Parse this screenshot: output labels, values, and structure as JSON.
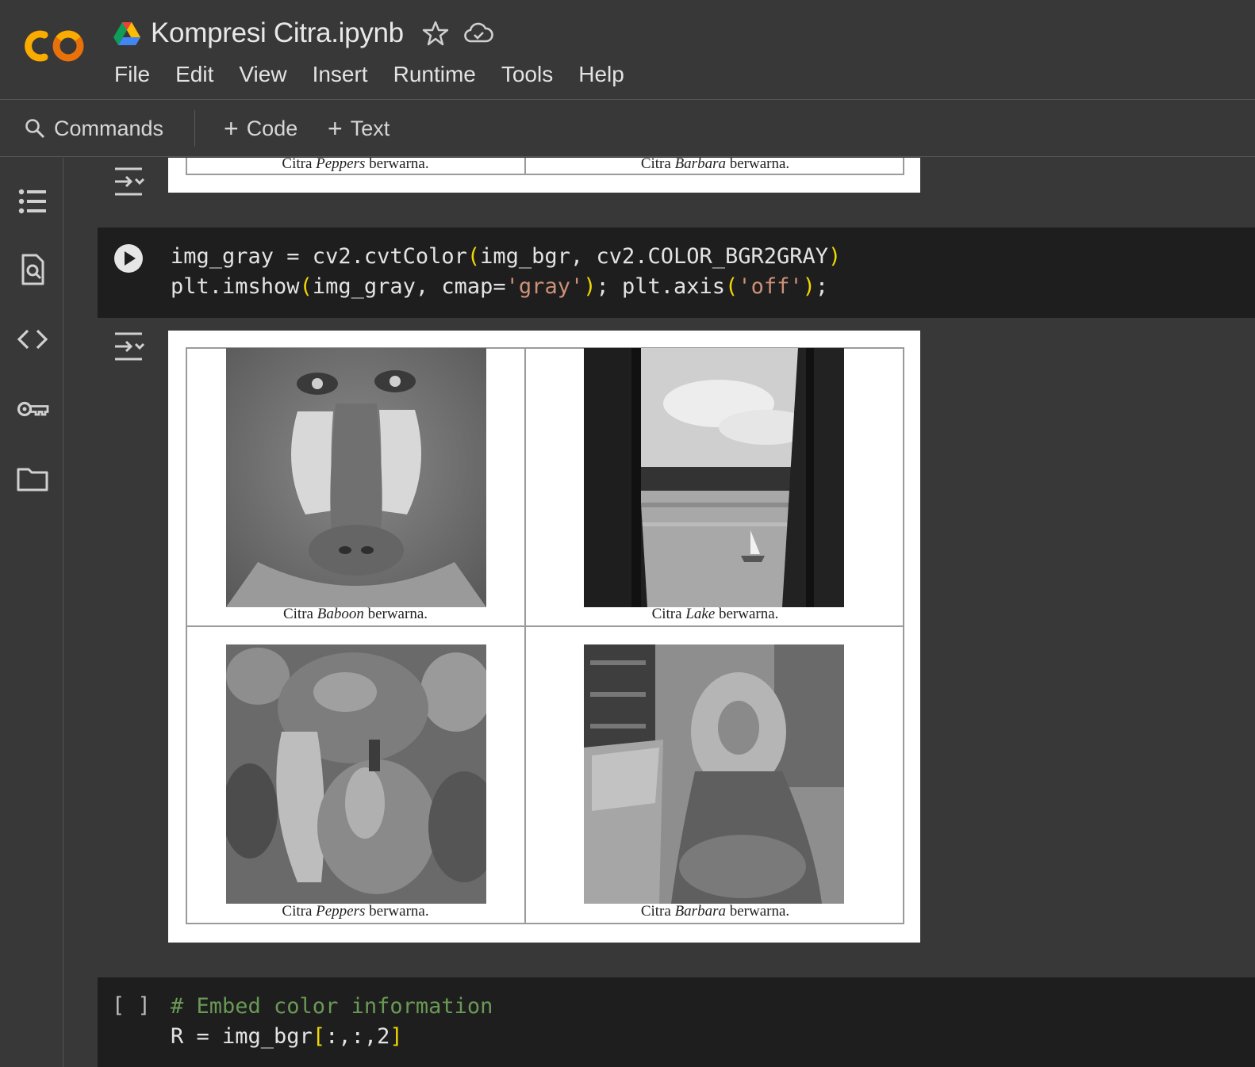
{
  "header": {
    "notebook_title": "Kompresi Citra.ipynb",
    "menu": [
      "File",
      "Edit",
      "View",
      "Insert",
      "Runtime",
      "Tools",
      "Help"
    ]
  },
  "toolbar": {
    "commands_label": "Commands",
    "add_code_label": "Code",
    "add_text_label": "Text"
  },
  "sidebar": {
    "icons": [
      "table-of-contents-icon",
      "find-replace-icon",
      "code-snippets-icon",
      "secrets-key-icon",
      "files-folder-icon"
    ]
  },
  "top_output": {
    "captions": [
      {
        "pre": "Citra ",
        "name": "Peppers",
        "post": " berwarna."
      },
      {
        "pre": "Citra ",
        "name": "Barbara",
        "post": " berwarna."
      }
    ]
  },
  "cell1": {
    "line1": {
      "a": "img_gray = cv2.cvtColor",
      "b": "(",
      "c": "img_bgr, cv2.COLOR_BGR2GRAY",
      "d": ")"
    },
    "line2": {
      "a": "plt.imshow",
      "b": "(",
      "c": "img_gray, cmap=",
      "s": "'gray'",
      "d": ")",
      "e": "; plt.axis",
      "f": "(",
      "g": "'off'",
      "h": ")",
      "i": ";"
    }
  },
  "main_output": {
    "captions": [
      {
        "pre": "Citra ",
        "name": "Baboon",
        "post": " berwarna."
      },
      {
        "pre": "Citra ",
        "name": "Lake",
        "post": " berwarna."
      },
      {
        "pre": "Citra ",
        "name": "Peppers",
        "post": " berwarna."
      },
      {
        "pre": "Citra ",
        "name": "Barbara",
        "post": " berwarna."
      }
    ]
  },
  "cell2": {
    "exec_indicator": "[ ]",
    "line1": "# Embed color information",
    "line2": {
      "a": "R = img_bgr",
      "b": "[",
      "c": ":,:,2",
      "d": "]"
    }
  }
}
